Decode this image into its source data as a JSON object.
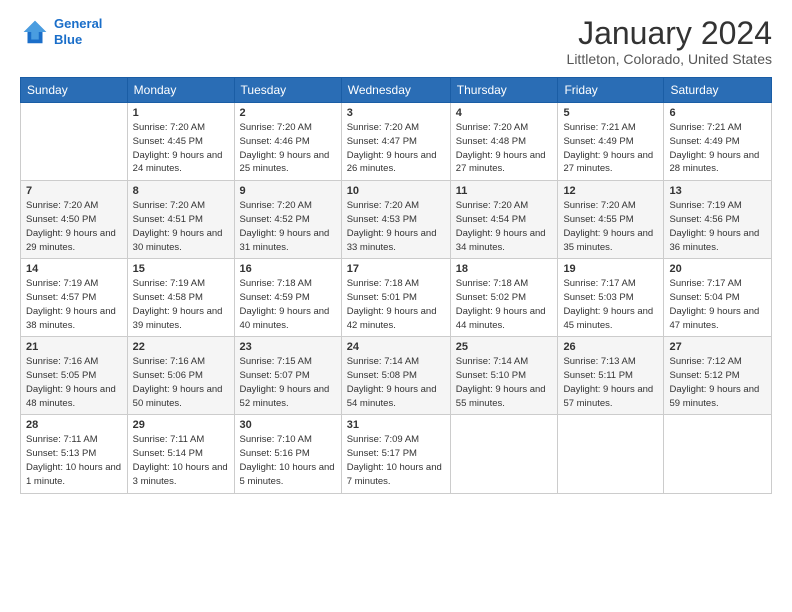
{
  "logo": {
    "line1": "General",
    "line2": "Blue"
  },
  "title": "January 2024",
  "subtitle": "Littleton, Colorado, United States",
  "days_header": [
    "Sunday",
    "Monday",
    "Tuesday",
    "Wednesday",
    "Thursday",
    "Friday",
    "Saturday"
  ],
  "weeks": [
    [
      {
        "day": "",
        "sunrise": "",
        "sunset": "",
        "daylight": ""
      },
      {
        "day": "1",
        "sunrise": "Sunrise: 7:20 AM",
        "sunset": "Sunset: 4:45 PM",
        "daylight": "Daylight: 9 hours and 24 minutes."
      },
      {
        "day": "2",
        "sunrise": "Sunrise: 7:20 AM",
        "sunset": "Sunset: 4:46 PM",
        "daylight": "Daylight: 9 hours and 25 minutes."
      },
      {
        "day": "3",
        "sunrise": "Sunrise: 7:20 AM",
        "sunset": "Sunset: 4:47 PM",
        "daylight": "Daylight: 9 hours and 26 minutes."
      },
      {
        "day": "4",
        "sunrise": "Sunrise: 7:20 AM",
        "sunset": "Sunset: 4:48 PM",
        "daylight": "Daylight: 9 hours and 27 minutes."
      },
      {
        "day": "5",
        "sunrise": "Sunrise: 7:21 AM",
        "sunset": "Sunset: 4:49 PM",
        "daylight": "Daylight: 9 hours and 27 minutes."
      },
      {
        "day": "6",
        "sunrise": "Sunrise: 7:21 AM",
        "sunset": "Sunset: 4:49 PM",
        "daylight": "Daylight: 9 hours and 28 minutes."
      }
    ],
    [
      {
        "day": "7",
        "sunrise": "Sunrise: 7:20 AM",
        "sunset": "Sunset: 4:50 PM",
        "daylight": "Daylight: 9 hours and 29 minutes."
      },
      {
        "day": "8",
        "sunrise": "Sunrise: 7:20 AM",
        "sunset": "Sunset: 4:51 PM",
        "daylight": "Daylight: 9 hours and 30 minutes."
      },
      {
        "day": "9",
        "sunrise": "Sunrise: 7:20 AM",
        "sunset": "Sunset: 4:52 PM",
        "daylight": "Daylight: 9 hours and 31 minutes."
      },
      {
        "day": "10",
        "sunrise": "Sunrise: 7:20 AM",
        "sunset": "Sunset: 4:53 PM",
        "daylight": "Daylight: 9 hours and 33 minutes."
      },
      {
        "day": "11",
        "sunrise": "Sunrise: 7:20 AM",
        "sunset": "Sunset: 4:54 PM",
        "daylight": "Daylight: 9 hours and 34 minutes."
      },
      {
        "day": "12",
        "sunrise": "Sunrise: 7:20 AM",
        "sunset": "Sunset: 4:55 PM",
        "daylight": "Daylight: 9 hours and 35 minutes."
      },
      {
        "day": "13",
        "sunrise": "Sunrise: 7:19 AM",
        "sunset": "Sunset: 4:56 PM",
        "daylight": "Daylight: 9 hours and 36 minutes."
      }
    ],
    [
      {
        "day": "14",
        "sunrise": "Sunrise: 7:19 AM",
        "sunset": "Sunset: 4:57 PM",
        "daylight": "Daylight: 9 hours and 38 minutes."
      },
      {
        "day": "15",
        "sunrise": "Sunrise: 7:19 AM",
        "sunset": "Sunset: 4:58 PM",
        "daylight": "Daylight: 9 hours and 39 minutes."
      },
      {
        "day": "16",
        "sunrise": "Sunrise: 7:18 AM",
        "sunset": "Sunset: 4:59 PM",
        "daylight": "Daylight: 9 hours and 40 minutes."
      },
      {
        "day": "17",
        "sunrise": "Sunrise: 7:18 AM",
        "sunset": "Sunset: 5:01 PM",
        "daylight": "Daylight: 9 hours and 42 minutes."
      },
      {
        "day": "18",
        "sunrise": "Sunrise: 7:18 AM",
        "sunset": "Sunset: 5:02 PM",
        "daylight": "Daylight: 9 hours and 44 minutes."
      },
      {
        "day": "19",
        "sunrise": "Sunrise: 7:17 AM",
        "sunset": "Sunset: 5:03 PM",
        "daylight": "Daylight: 9 hours and 45 minutes."
      },
      {
        "day": "20",
        "sunrise": "Sunrise: 7:17 AM",
        "sunset": "Sunset: 5:04 PM",
        "daylight": "Daylight: 9 hours and 47 minutes."
      }
    ],
    [
      {
        "day": "21",
        "sunrise": "Sunrise: 7:16 AM",
        "sunset": "Sunset: 5:05 PM",
        "daylight": "Daylight: 9 hours and 48 minutes."
      },
      {
        "day": "22",
        "sunrise": "Sunrise: 7:16 AM",
        "sunset": "Sunset: 5:06 PM",
        "daylight": "Daylight: 9 hours and 50 minutes."
      },
      {
        "day": "23",
        "sunrise": "Sunrise: 7:15 AM",
        "sunset": "Sunset: 5:07 PM",
        "daylight": "Daylight: 9 hours and 52 minutes."
      },
      {
        "day": "24",
        "sunrise": "Sunrise: 7:14 AM",
        "sunset": "Sunset: 5:08 PM",
        "daylight": "Daylight: 9 hours and 54 minutes."
      },
      {
        "day": "25",
        "sunrise": "Sunrise: 7:14 AM",
        "sunset": "Sunset: 5:10 PM",
        "daylight": "Daylight: 9 hours and 55 minutes."
      },
      {
        "day": "26",
        "sunrise": "Sunrise: 7:13 AM",
        "sunset": "Sunset: 5:11 PM",
        "daylight": "Daylight: 9 hours and 57 minutes."
      },
      {
        "day": "27",
        "sunrise": "Sunrise: 7:12 AM",
        "sunset": "Sunset: 5:12 PM",
        "daylight": "Daylight: 9 hours and 59 minutes."
      }
    ],
    [
      {
        "day": "28",
        "sunrise": "Sunrise: 7:11 AM",
        "sunset": "Sunset: 5:13 PM",
        "daylight": "Daylight: 10 hours and 1 minute."
      },
      {
        "day": "29",
        "sunrise": "Sunrise: 7:11 AM",
        "sunset": "Sunset: 5:14 PM",
        "daylight": "Daylight: 10 hours and 3 minutes."
      },
      {
        "day": "30",
        "sunrise": "Sunrise: 7:10 AM",
        "sunset": "Sunset: 5:16 PM",
        "daylight": "Daylight: 10 hours and 5 minutes."
      },
      {
        "day": "31",
        "sunrise": "Sunrise: 7:09 AM",
        "sunset": "Sunset: 5:17 PM",
        "daylight": "Daylight: 10 hours and 7 minutes."
      },
      {
        "day": "",
        "sunrise": "",
        "sunset": "",
        "daylight": ""
      },
      {
        "day": "",
        "sunrise": "",
        "sunset": "",
        "daylight": ""
      },
      {
        "day": "",
        "sunrise": "",
        "sunset": "",
        "daylight": ""
      }
    ]
  ]
}
